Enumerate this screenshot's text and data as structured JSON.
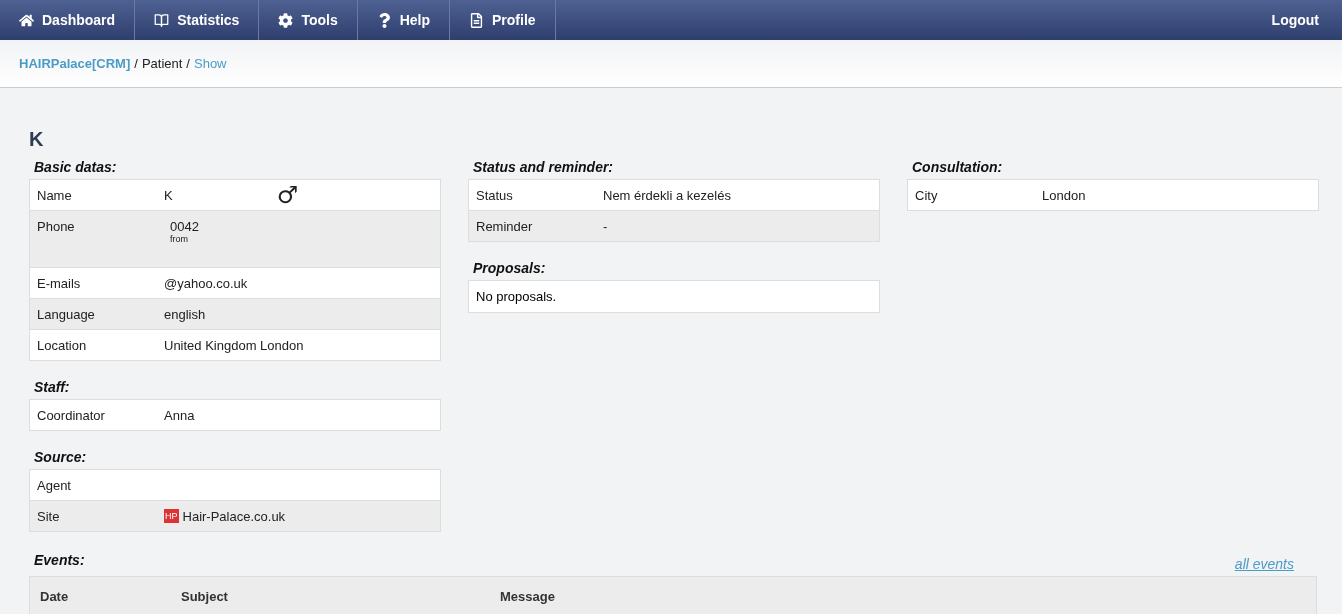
{
  "nav": {
    "items": [
      {
        "label": "Dashboard"
      },
      {
        "label": "Statistics"
      },
      {
        "label": "Tools"
      },
      {
        "label": "Help"
      },
      {
        "label": "Profile"
      }
    ],
    "logout": "Logout"
  },
  "breadcrumb": {
    "home": "HAIRPalace[CRM]",
    "separator_1": "/",
    "section": "Patient",
    "separator_2": "/",
    "current": "Show"
  },
  "title": "K",
  "columns": [
    [
      {
        "title": "Basic datas:",
        "rows": [
          {
            "label": "Name",
            "value": "K",
            "gender": "♂"
          },
          {
            "label": "Phone",
            "value": "0042",
            "note": "from"
          },
          {
            "label": "E-mails",
            "value": "@yahoo.co.uk"
          },
          {
            "label": "Language",
            "value": "english"
          },
          {
            "label": "Location",
            "value": "United Kingdom London"
          }
        ]
      },
      {
        "title": "Staff:",
        "rows": [
          {
            "label": "Coordinator",
            "value": "Anna"
          }
        ]
      },
      {
        "title": "Source:",
        "rows": [
          {
            "label": "Agent"
          },
          {
            "label": "Site",
            "value": "Hair-Palace.co.uk",
            "logo": "HP"
          }
        ]
      }
    ],
    [
      {
        "title": "Status and reminder:",
        "rows": [
          {
            "label": "Status",
            "value": "Nem érdekli a kezelés"
          },
          {
            "label": "Reminder",
            "value": "-"
          }
        ]
      },
      {
        "title": "Proposals:",
        "empty": "No proposals."
      }
    ],
    [
      {
        "title": "Consultation:",
        "rows": [
          {
            "label": "City",
            "value": "London"
          }
        ]
      }
    ]
  ],
  "events": {
    "title": "Events:",
    "link": "all events",
    "columns": [
      "Date",
      "Subject",
      "Message"
    ]
  }
}
